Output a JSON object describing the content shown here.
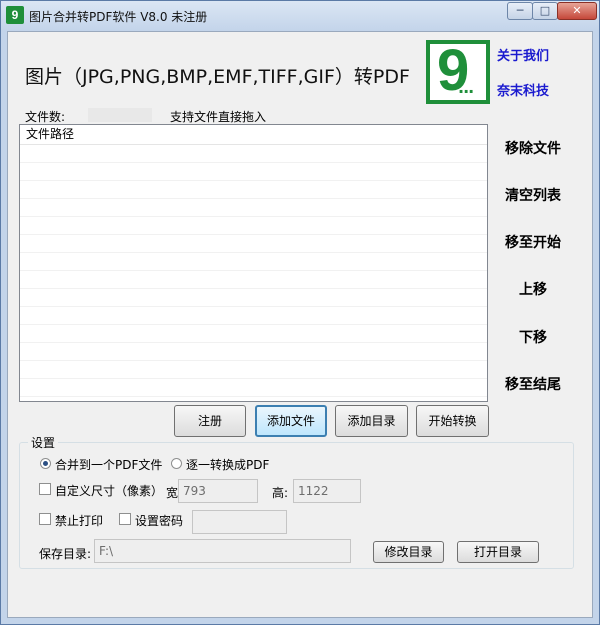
{
  "window": {
    "title": "图片合并转PDF软件 V8.0 未注册",
    "app_icon_glyph": "9",
    "controls": {
      "minimize": "─",
      "maximize": "□",
      "close": "✕"
    }
  },
  "header": {
    "headline": "图片（JPG,PNG,BMP,EMF,TIFF,GIF）转PDF",
    "logo_glyph": "9",
    "logo_dots": "...",
    "about_link": "关于我们",
    "company_link": "奈末科技"
  },
  "file_info": {
    "count_label": "文件数:",
    "count_value": "",
    "drag_hint": "支持文件直接拖入"
  },
  "file_list": {
    "column_header": "文件路径",
    "rows": []
  },
  "side_actions": {
    "remove_file": "移除文件",
    "clear_list": "清空列表",
    "move_to_start": "移至开始",
    "move_up": "上移",
    "move_down": "下移",
    "move_to_end": "移至结尾"
  },
  "main_buttons": {
    "register": "注册",
    "add_file": "添加文件",
    "add_directory": "添加目录",
    "start_convert": "开始转换"
  },
  "settings": {
    "group_title": "设置",
    "merge_option": "合并到一个PDF文件",
    "merge_selected": true,
    "each_option": "逐一转换成PDF",
    "custom_size_label": "自定义尺寸（像素）",
    "custom_size_checked": false,
    "width_label": "宽:",
    "width_value": "793",
    "height_label": "高:",
    "height_value": "1122",
    "no_print_label": "禁止打印",
    "no_print_checked": false,
    "set_password_label": "设置密码",
    "set_password_checked": false,
    "password_value": "",
    "save_dir_label": "保存目录:",
    "save_dir_value": "F:\\",
    "modify_dir_button": "修改目录",
    "open_dir_button": "打开目录"
  },
  "colors": {
    "brand_green": "#1f8f3a",
    "link_blue": "#1a1acf",
    "window_frame": "#c3d4ea",
    "client_bg": "#f0f0f0"
  }
}
